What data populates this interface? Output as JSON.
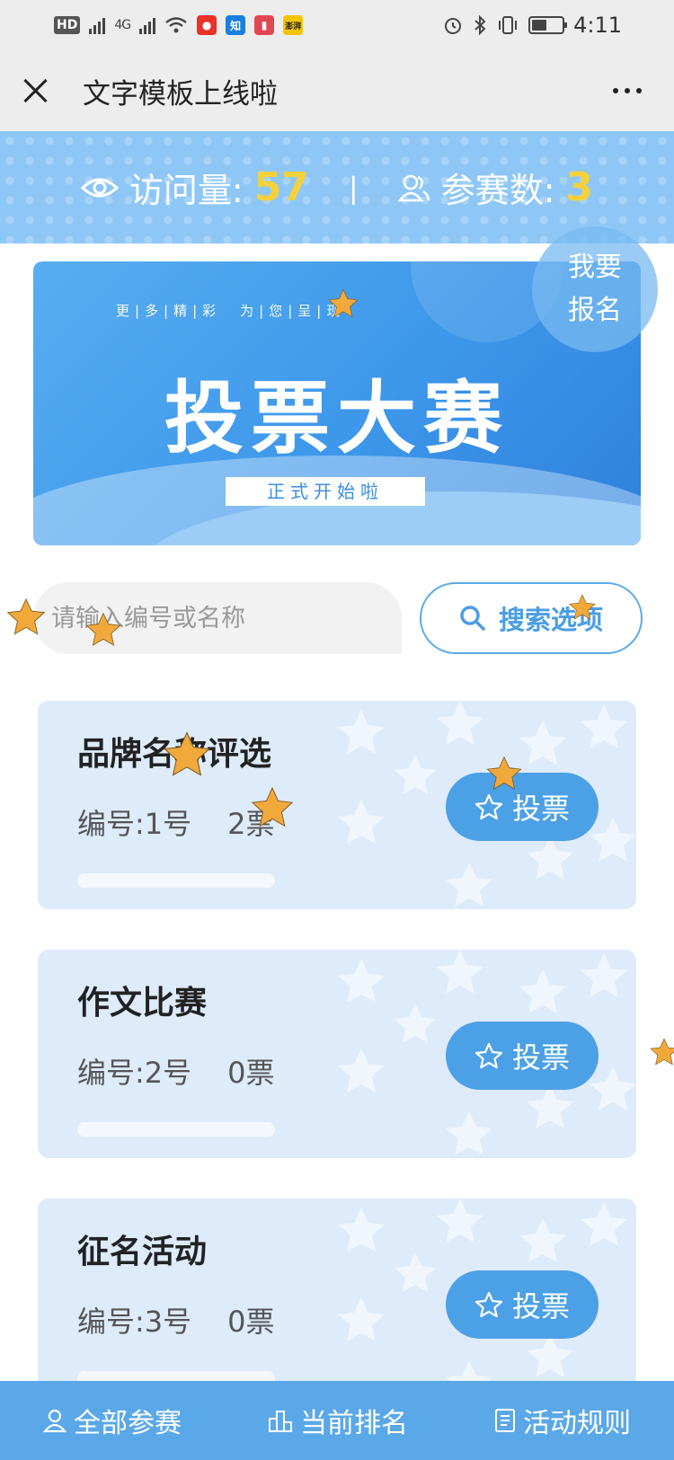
{
  "statusbar": {
    "network": "HD",
    "signal_labels": [
      "4G"
    ],
    "app_icons": [
      "weibo-icon",
      "zhihu-icon",
      "book-icon",
      "news-icon"
    ],
    "app_icon_labels": [
      "知",
      "澎湃"
    ],
    "time": "4:11"
  },
  "titlebar": {
    "title": "文字模板上线啦"
  },
  "stats": {
    "visits_label": "访问量:",
    "visits_value": "57",
    "separator": "|",
    "entrants_label": "参赛数:",
    "entrants_value": "3"
  },
  "hero": {
    "tagline": "更|多|精|彩　为|您|呈|现",
    "title": "投票大赛",
    "subtitle": "正式开始啦"
  },
  "signup": {
    "label": "我要报名"
  },
  "search": {
    "placeholder": "请输入编号或名称",
    "button_label": "搜索选项"
  },
  "entries": [
    {
      "title": "品牌名称评选",
      "number": "编号:1号",
      "votes": "2票",
      "vote_label": "投票"
    },
    {
      "title": "作文比赛",
      "number": "编号:2号",
      "votes": "0票",
      "vote_label": "投票"
    },
    {
      "title": "征名活动",
      "number": "编号:3号",
      "votes": "0票",
      "vote_label": "投票"
    }
  ],
  "bottom_nav": {
    "all_entries": "全部参赛",
    "ranking": "当前排名",
    "rules": "活动规则"
  },
  "colors": {
    "accent": "#4ca0e6",
    "stats_bg": "#8ec7f6",
    "highlight": "#f7d13a",
    "card_bg": "#deebfa",
    "star": "#f2a93b"
  }
}
